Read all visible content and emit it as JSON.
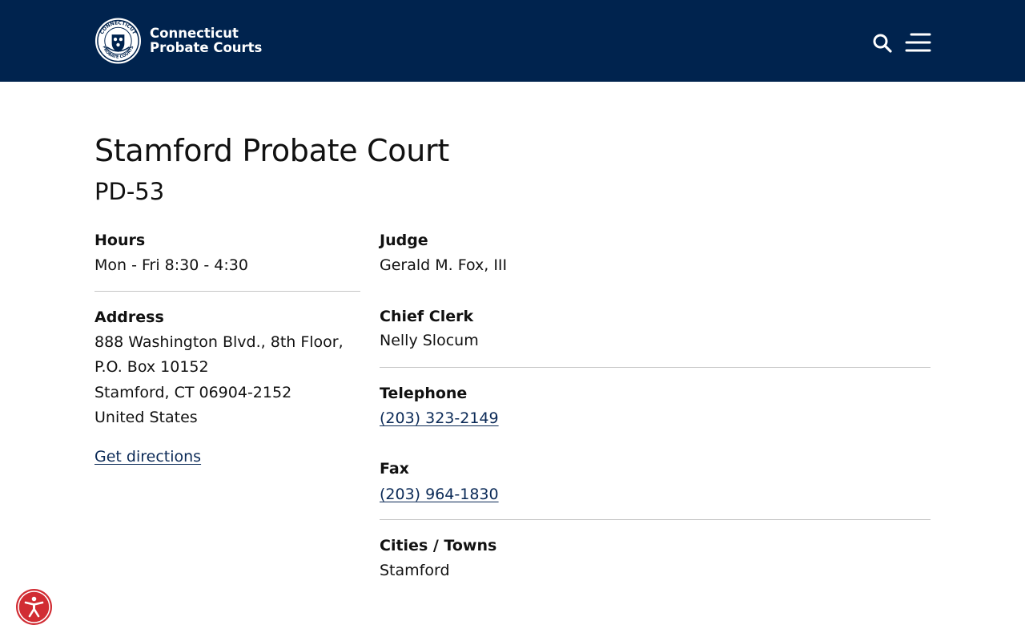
{
  "header": {
    "logo_line1": "Connecticut",
    "logo_line2": "Probate Courts",
    "seal_text_top": "CONNECTICUT",
    "seal_text_bottom": "PROBATE COURTS",
    "bg_color": "#00234e"
  },
  "page": {
    "title": "Stamford Probate Court",
    "district": "PD-53"
  },
  "details": {
    "hours_label": "Hours",
    "hours_value": "Mon - Fri 8:30 - 4:30",
    "address_label": "Address",
    "address_lines": [
      "888 Washington Blvd., 8th Floor,",
      "P.O. Box 10152",
      "Stamford, CT 06904-2152",
      "United States"
    ],
    "directions_link": "Get directions",
    "judge_label": "Judge",
    "judge_value": "Gerald M. Fox, III",
    "clerk_label": "Chief Clerk",
    "clerk_value": "Nelly Slocum",
    "telephone_label": "Telephone",
    "telephone_value": "(203) 323-2149",
    "fax_label": "Fax",
    "fax_value": "(203) 964-1830",
    "towns_label": "Cities / Towns",
    "towns_value": "Stamford"
  },
  "icons": {
    "search": "search-icon",
    "menu": "menu-icon",
    "accessibility": "accessibility-icon"
  },
  "colors": {
    "link": "#0b2a57",
    "accessibility": "#d12c33"
  }
}
